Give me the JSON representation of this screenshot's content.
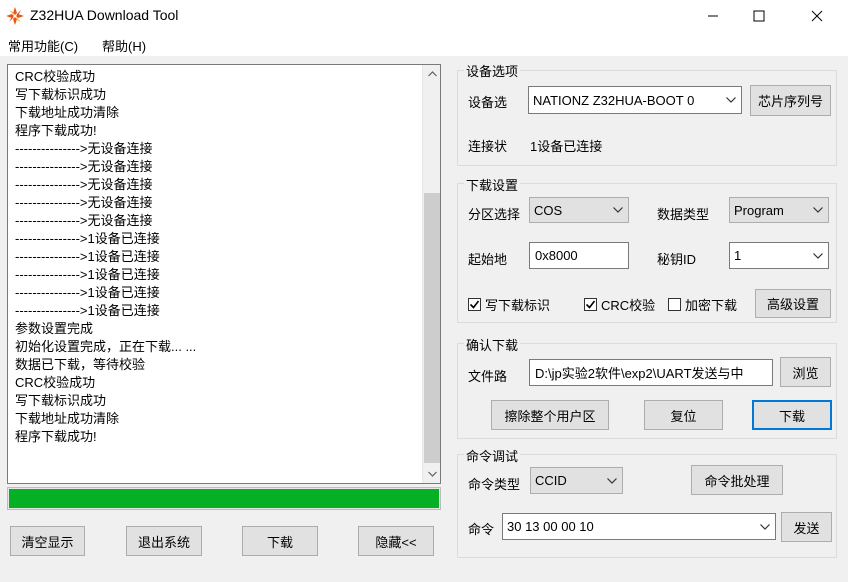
{
  "window": {
    "title": "Z32HUA Download Tool",
    "minimize_icon": "minimize-icon",
    "maximize_icon": "maximize-icon",
    "close_icon": "close-icon"
  },
  "menu": {
    "items": [
      {
        "label": "常用功能(C)"
      },
      {
        "label": "帮助(H)"
      }
    ]
  },
  "log": {
    "lines": [
      "CRC校验成功",
      "写下载标识成功",
      "下载地址成功清除",
      "程序下载成功!",
      "--------------->无设备连接",
      "--------------->无设备连接",
      "--------------->无设备连接",
      "--------------->无设备连接",
      "--------------->无设备连接",
      "--------------->1设备已连接",
      "--------------->1设备已连接",
      "--------------->1设备已连接",
      "--------------->1设备已连接",
      "--------------->1设备已连接",
      "参数设置完成",
      "初始化设置完成，正在下载... ...",
      "数据已下载，等待校验",
      "CRC校验成功",
      "写下载标识成功",
      "下载地址成功清除",
      "程序下载成功!"
    ]
  },
  "progress": {
    "percent": 100,
    "color": "#06b025"
  },
  "bottom_buttons": {
    "clear": "清空显示",
    "exit": "退出系统",
    "download": "下载",
    "hide": "隐藏<<"
  },
  "device": {
    "group_title": "设备选项",
    "select_label": "设备选",
    "select_value": "NATIONZ Z32HUA-BOOT 0",
    "serial_button": "芯片序列号",
    "status_label": "连接状",
    "status_value": "1设备已连接"
  },
  "download_settings": {
    "group_title": "下载设置",
    "partition_label": "分区选择",
    "partition_value": "COS",
    "datatype_label": "数据类型",
    "datatype_value": "Program",
    "start_label": "起始地",
    "start_value": "0x8000",
    "key_label": "秘钥ID",
    "key_value": "1",
    "chk_write_flag": "写下载标识",
    "chk_write_flag_checked": true,
    "chk_crc": "CRC校验",
    "chk_crc_checked": true,
    "chk_encrypt": "加密下载",
    "chk_encrypt_checked": false,
    "advanced_button": "高级设置"
  },
  "confirm": {
    "group_title": "确认下载",
    "file_label": "文件路",
    "file_value": "D:\\jp实验2软件\\exp2\\UART发送与中",
    "browse_button": "浏览",
    "erase_button": "擦除整个用户区",
    "reset_button": "复位",
    "download_button": "下载"
  },
  "command": {
    "group_title": "命令调试",
    "type_label": "命令类型",
    "type_value": "CCID",
    "batch_button": "命令批处理",
    "cmd_label": "命令",
    "cmd_value": "30 13 00 00 10",
    "send_button": "发送"
  }
}
